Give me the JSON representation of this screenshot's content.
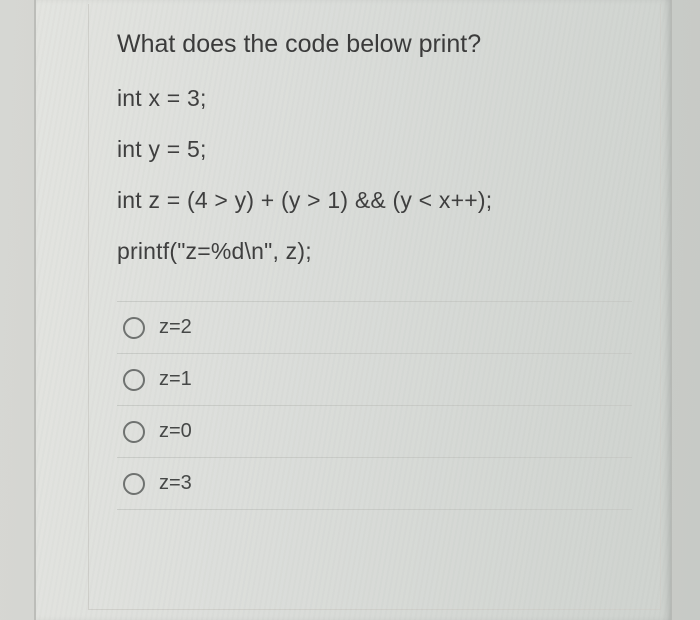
{
  "question": "What does the code below print?",
  "code_lines": [
    "int x = 3;",
    "int y = 5;",
    "int z = (4 > y) + (y > 1) && (y < x++);",
    "printf(\"z=%d\\n\", z);"
  ],
  "options": [
    {
      "label": "z=2"
    },
    {
      "label": "z=1"
    },
    {
      "label": "z=0"
    },
    {
      "label": "z=3"
    }
  ]
}
